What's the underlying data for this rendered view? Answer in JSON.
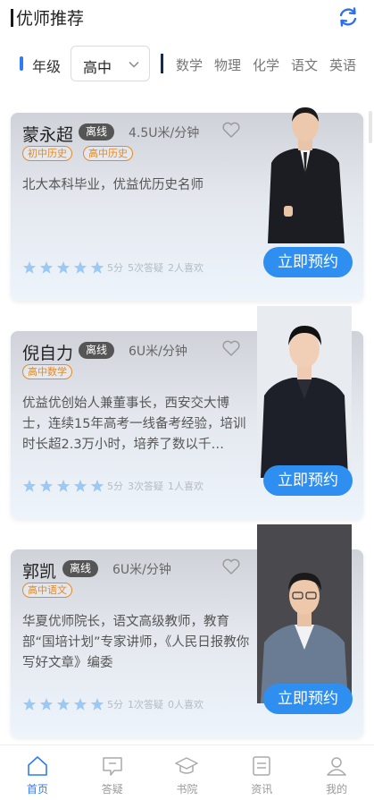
{
  "header": {
    "title": "优师推荐",
    "refresh_icon": "refresh-icon"
  },
  "filter": {
    "grade_label": "年级",
    "grade_value": "高中",
    "subjects": [
      "数学",
      "物理",
      "化学",
      "语文",
      "英语"
    ]
  },
  "teachers": [
    {
      "name": "蒙永超",
      "status": "离线",
      "price": "4.5U米/分钟",
      "tags": [
        "初中历史",
        "高中历史"
      ],
      "description": "北大本科毕业，优益优历史名师",
      "rating_text": "5分",
      "answers": "5次答疑",
      "likes": "2人喜欢",
      "stars": 5,
      "book_label": "立即预约"
    },
    {
      "name": "倪自力",
      "status": "离线",
      "price": "6U米/分钟",
      "tags": [
        "高中数学"
      ],
      "description": "优益优创始人兼董事长，西安交大博士，连续15年高考一线备考经验，培训时长超2.3万小时，培养了数以千…",
      "rating_text": "5分",
      "answers": "3次答疑",
      "likes": "1人喜欢",
      "stars": 5,
      "book_label": "立即预约"
    },
    {
      "name": "郭凯",
      "status": "离线",
      "price": "6U米/分钟",
      "tags": [
        "高中语文"
      ],
      "description": "华夏优师院长，语文高级教师，教育部“国培计划”专家讲师，《人民日报教你写好文章》编委",
      "rating_text": "5分",
      "answers": "1次答疑",
      "likes": "0人喜欢",
      "stars": 5,
      "book_label": "立即预约"
    }
  ],
  "tabbar": [
    {
      "label": "首页",
      "icon": "home-icon",
      "active": true
    },
    {
      "label": "答疑",
      "icon": "chat-icon",
      "active": false
    },
    {
      "label": "书院",
      "icon": "graduation-cap-icon",
      "active": false
    },
    {
      "label": "资讯",
      "icon": "news-icon",
      "active": false
    },
    {
      "label": "我的",
      "icon": "profile-icon",
      "active": false
    }
  ],
  "colors": {
    "accent": "#2f7bf6",
    "book_button": "#2f8ff0",
    "tag": "#e38a2b",
    "star": "#9cc8f4"
  }
}
